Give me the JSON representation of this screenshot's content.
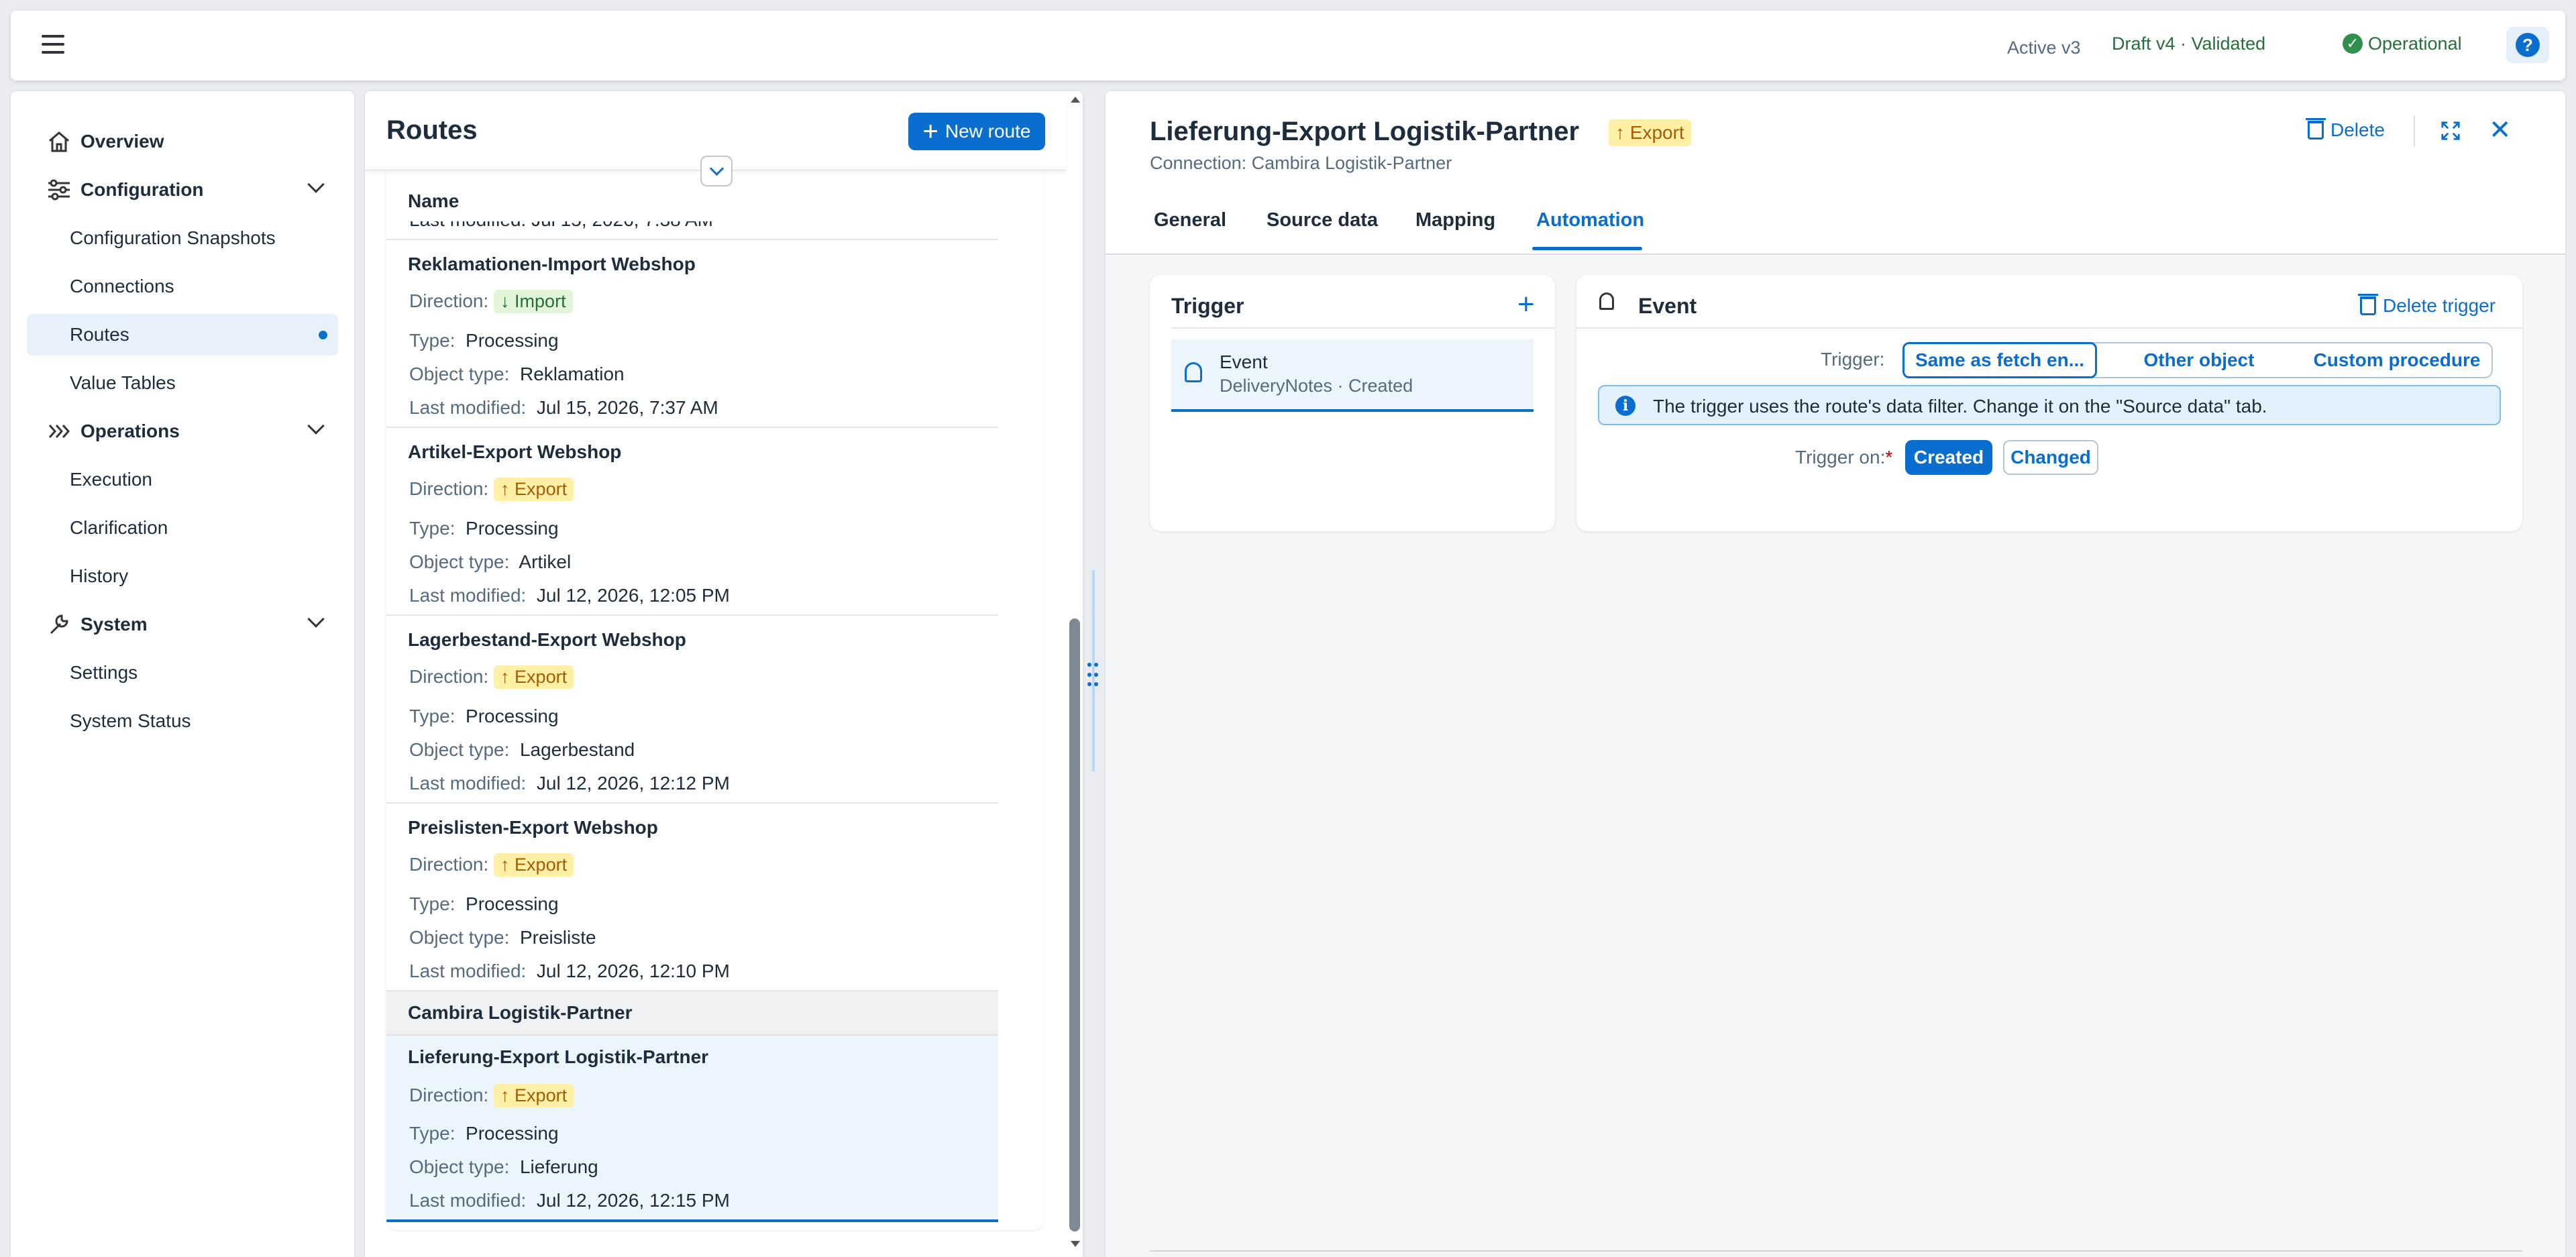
{
  "shell": {
    "active_version": "Active v3",
    "draft_status": "Draft v4 · Validated",
    "operational": "Operational",
    "help": "?"
  },
  "nav": {
    "overview": "Overview",
    "configuration": "Configuration",
    "configuration_snapshots": "Configuration Snapshots",
    "connections": "Connections",
    "routes": "Routes",
    "value_tables": "Value Tables",
    "operations": "Operations",
    "execution": "Execution",
    "clarification": "Clarification",
    "history": "History",
    "system": "System",
    "settings": "Settings",
    "system_status": "System Status"
  },
  "routes": {
    "title": "Routes",
    "new_route": "New route",
    "column_name": "Name",
    "labels": {
      "direction": "Direction:",
      "type": "Type:",
      "object_type": "Object type:",
      "last_modified": "Last modified:"
    },
    "partial_last_modified": "Last modified:   Jul 15, 2026, 7:38 AM",
    "items": [
      {
        "name": "Reklamationen-Import Webshop",
        "direction": "↓ Import",
        "type": "Processing",
        "object_type": "Reklamation",
        "last_modified": "Jul 15, 2026, 7:37 AM"
      },
      {
        "name": "Artikel-Export Webshop",
        "direction": "↑ Export",
        "type": "Processing",
        "object_type": "Artikel",
        "last_modified": "Jul 12, 2026, 12:05 PM"
      },
      {
        "name": "Lagerbestand-Export Webshop",
        "direction": "↑ Export",
        "type": "Processing",
        "object_type": "Lagerbestand",
        "last_modified": "Jul 12, 2026, 12:12 PM"
      },
      {
        "name": "Preislisten-Export Webshop",
        "direction": "↑ Export",
        "type": "Processing",
        "object_type": "Preisliste",
        "last_modified": "Jul 12, 2026, 12:10 PM"
      }
    ],
    "group_header": "Cambira Logistik-Partner",
    "selected": {
      "name": "Lieferung-Export Logistik-Partner",
      "direction": "↑ Export",
      "type": "Processing",
      "object_type": "Lieferung",
      "last_modified": "Jul 12, 2026, 12:15 PM"
    }
  },
  "detail": {
    "title": "Lieferung-Export Logistik-Partner",
    "badge": "↑ Export",
    "connection": "Connection: Cambira Logistik-Partner",
    "delete": "Delete",
    "close": "✕",
    "tabs": [
      "General",
      "Source data",
      "Mapping",
      "Automation"
    ],
    "active_tab": "Automation"
  },
  "trigger_card": {
    "title": "Trigger",
    "add": "+",
    "item_title": "Event",
    "item_subtitle": "DeliveryNotes · Created"
  },
  "event_card": {
    "title": "Event",
    "delete_trigger": "Delete trigger",
    "trigger_label": "Trigger:",
    "segments": [
      "Same as fetch en...",
      "Other object",
      "Custom procedure"
    ],
    "info": "The trigger uses the route's data filter. Change it on the \"Source data\" tab.",
    "trigger_on_label": "Trigger on:",
    "required_mark": "*",
    "created": "Created",
    "changed": "Changed"
  },
  "colors": {
    "accent": "#0a6ed1",
    "success": "#30914c",
    "export_badge": "#fef0a6",
    "import_badge": "#e2f5d9"
  }
}
